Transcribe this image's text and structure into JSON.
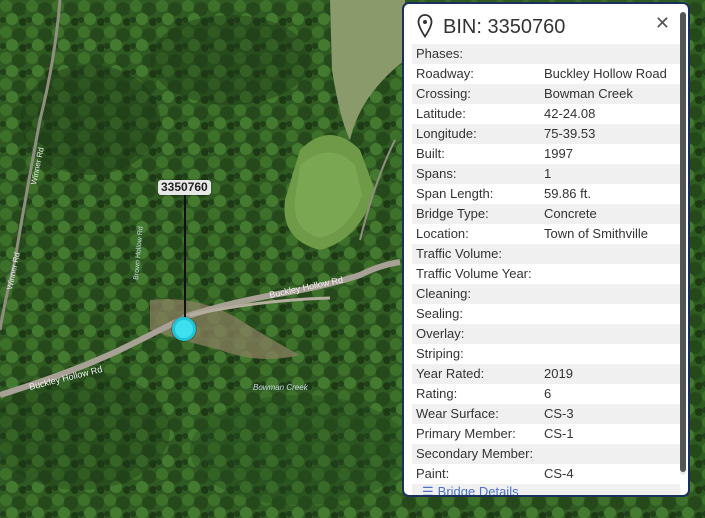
{
  "map": {
    "marker_label": "3350760",
    "marker_color": "#3ee0ef",
    "road_labels": {
      "buckley_west": "Buckley Hollow Rd",
      "buckley_east": "Buckley Hollow Rd",
      "winner": "Winner Rd",
      "bowman_creek": "Bowman Creek",
      "side_road": "Brown Hollow Rd"
    }
  },
  "popup": {
    "title": "BIN: 3350760",
    "close_icon": "✕",
    "attributes": [
      {
        "name": "Phases:",
        "value": ""
      },
      {
        "name": "Roadway:",
        "value": "Buckley Hollow Road"
      },
      {
        "name": "Crossing:",
        "value": "Bowman Creek"
      },
      {
        "name": "Latitude:",
        "value": "42-24.08"
      },
      {
        "name": "Longitude:",
        "value": "75-39.53"
      },
      {
        "name": "Built:",
        "value": "1997"
      },
      {
        "name": "Spans:",
        "value": "1"
      },
      {
        "name": "Span Length:",
        "value": "59.86 ft."
      },
      {
        "name": "Bridge Type:",
        "value": "Concrete"
      },
      {
        "name": "Location:",
        "value": "Town of Smithville"
      },
      {
        "name": "Traffic Volume:",
        "value": ""
      },
      {
        "name": "Traffic Volume Year:",
        "value": ""
      },
      {
        "name": "Cleaning:",
        "value": ""
      },
      {
        "name": "Sealing:",
        "value": ""
      },
      {
        "name": "Overlay:",
        "value": ""
      },
      {
        "name": "Striping:",
        "value": ""
      },
      {
        "name": "Year Rated:",
        "value": "2019"
      },
      {
        "name": "Rating:",
        "value": "6"
      },
      {
        "name": "Wear Surface:",
        "value": "CS-3"
      },
      {
        "name": "Primary Member:",
        "value": "CS-1"
      },
      {
        "name": "Secondary Member:",
        "value": ""
      },
      {
        "name": "Paint:",
        "value": "CS-4"
      }
    ],
    "details_link": "Bridge Details",
    "border_color": "#1b2f5c",
    "link_color": "#4a72c8"
  }
}
